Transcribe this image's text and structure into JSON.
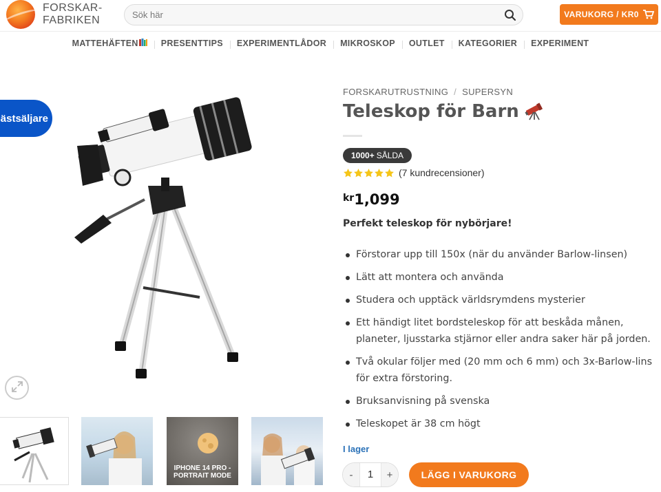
{
  "header": {
    "logo_line1": "FORSKAR-",
    "logo_line2": "FABRIKEN",
    "search_placeholder": "Sök här",
    "cart_label": "VARUKORG / KR0"
  },
  "nav": {
    "items": [
      "MATTEHÄFTEN",
      "PRESENTTIPS",
      "EXPERIMENTLÅDOR",
      "MIKROSKOP",
      "OUTLET",
      "KATEGORIER",
      "EXPERIMENT"
    ]
  },
  "product": {
    "badge": "Bästsäljare",
    "breadcrumb": [
      "FORSKARUTRUSTNING",
      "SUPERSYN"
    ],
    "title": "Teleskop för Barn",
    "sold_count": "1000+",
    "sold_label": "SÅLDA",
    "rating": 5,
    "reviews": "(7 kundrecensioner)",
    "currency": "kr",
    "price": "1,099",
    "lead": "Perfekt teleskop för nybörjare!",
    "features": [
      "Förstorar upp till 150x (när du använder Barlow-linsen)",
      "Lätt att montera och använda",
      "Studera och upptäck världsrymdens mysterier",
      "Ett händigt litet bordsteleskop för att beskåda månen, planeter, ljusstarka stjärnor eller andra saker här på jorden.",
      "Två okular följer med (20 mm och 6 mm) och 3x-Barlow-lins för extra förstoring.",
      "Bruksanvisning på svenska",
      "Teleskopet är 38 cm högt"
    ],
    "stock": "I lager",
    "quantity": "1",
    "qty_minus": "-",
    "qty_plus": "+",
    "add_to_cart": "LÄGG I VARUKORG",
    "thumb3_caption_line1": "IPHONE 14 PRO -",
    "thumb3_caption_line2": "PORTRAIT MODE"
  },
  "colors": {
    "accent": "#f27a1d",
    "badge_blue": "#0a55c8",
    "stock_blue": "#2b72b8",
    "star": "#f5c518"
  },
  "icons": [
    "logo-mark",
    "search-icon",
    "cart-icon",
    "books-icon",
    "telescope-icon",
    "star-icon",
    "zoom-icon"
  ]
}
